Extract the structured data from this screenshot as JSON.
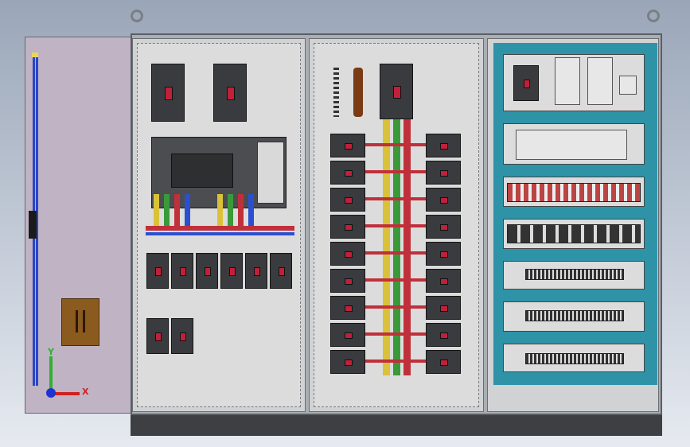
{
  "viewport": {
    "title": ""
  },
  "colors": {
    "background_top": "#9aa6b8",
    "cabinet_frame": "#5b5f64",
    "backplate": "#dcdcdc",
    "breaker": "#3a3b3e",
    "busbar_yellow": "#d9c23a",
    "busbar_green": "#3a9a3a",
    "busbar_red": "#c0303a",
    "busbar_blue": "#2a4fd0",
    "din_rail_teal": "#2f93a8"
  },
  "axis_triad": {
    "x_label": "X",
    "y_label": "Y"
  },
  "components": {
    "left_section": [
      "breaker",
      "breaker",
      "controller",
      "breaker-row"
    ],
    "middle_section": [
      "breaker-grid",
      "busbars"
    ],
    "right_section": [
      "power-supplies",
      "relay-rows",
      "terminal-blocks"
    ]
  }
}
